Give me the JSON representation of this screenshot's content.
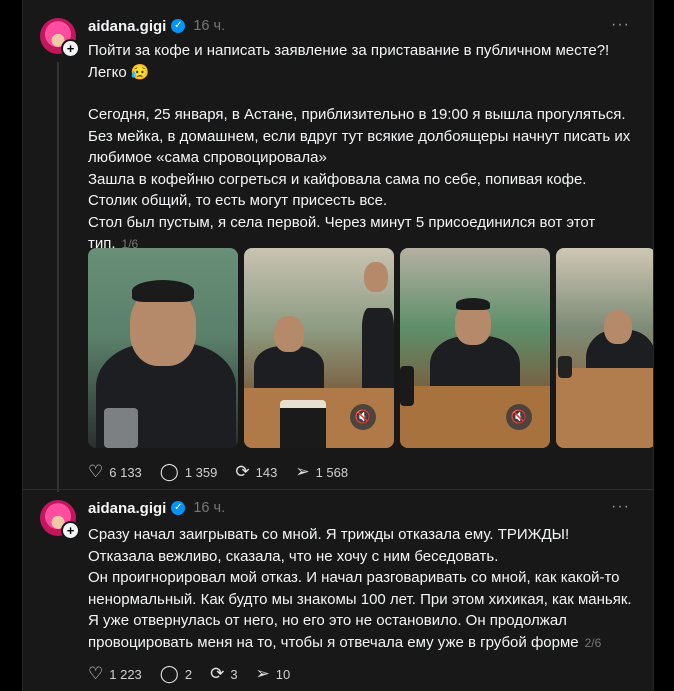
{
  "post1": {
    "username": "aidana.gigi",
    "time": "16 ч.",
    "more": "···",
    "paragraphs": [
      "Пойти за кофе и написать заявление за приставание в публичном месте?!",
      "Легко 😥",
      "",
      "Сегодня, 25 января, в Астане, приблизительно в 19:00 я вышла прогуляться.",
      "Без мейка, в домашнем, если вдруг тут всякие долбоящеры начнут писать их",
      "любимое «сама спровоцировала»",
      "Зашла в кофейню согреться и кайфовала сама по себе, попивая кофе.",
      "Столик общий, то есть могут присесть все.",
      "Стол был пустым, я села первой. Через минут 5 присоединился вот этот",
      "тип."
    ],
    "counter": "1/6",
    "media_icons": [
      "mute-icon",
      "mute-icon"
    ],
    "actions": {
      "likes": "6 133",
      "comments": "1 359",
      "reposts": "143",
      "shares": "1 568"
    }
  },
  "post2": {
    "username": "aidana.gigi",
    "time": "16 ч.",
    "more": "···",
    "paragraphs": [
      "Сразу начал заигрывать со мной. Я трижды отказала ему. ТРИЖДЫ!",
      "Отказала вежливо, сказала, что не хочу с ним беседовать.",
      "Он проигнорировал мой отказ. И начал разговаривать со мной, как какой-то",
      "ненормальный. Как будто мы знакомы 100 лет. При этом хихикая, как маньяк.",
      "Я уже отвернулась от него, но его это не остановило. Он продолжал",
      "провоцировать меня на то, чтобы я отвечала ему уже в грубой форме"
    ],
    "counter": "2/6",
    "actions": {
      "likes": "1 223",
      "comments": "2",
      "reposts": "3",
      "shares": "10"
    }
  },
  "colors": {
    "background": "#000000",
    "card": "#181818",
    "text": "#f3f5f7",
    "muted": "#777777",
    "verified": "#0095f6"
  }
}
